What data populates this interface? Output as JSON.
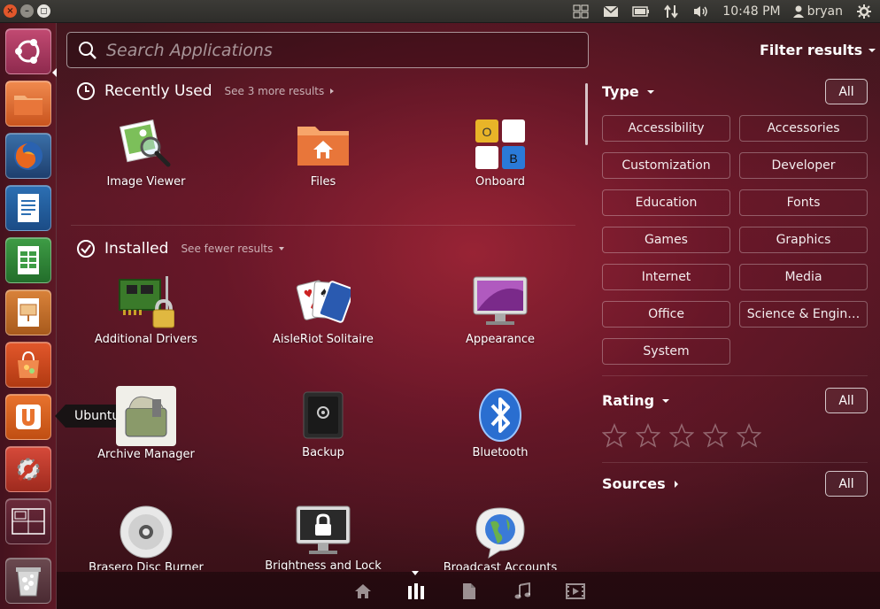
{
  "top_panel": {
    "time": "10:48 PM",
    "user": "bryan",
    "window_buttons": [
      "close-icon",
      "minimize-icon",
      "maximize-icon"
    ],
    "close_glyph": "×",
    "min_glyph": "–",
    "max_glyph": "◻",
    "indicator_icons": [
      "workspaces-icon",
      "mail-icon",
      "battery-icon",
      "network-icon",
      "volume-icon",
      "user-icon",
      "gear-icon"
    ]
  },
  "launcher": {
    "items": [
      "ubuntu-dash-icon",
      "files-icon",
      "firefox-icon",
      "writer-icon",
      "calc-icon",
      "impress-icon",
      "software-center-icon",
      "ubuntu-one-icon",
      "system-settings-icon",
      "workspace-switcher-icon",
      "trash-icon"
    ],
    "tooltip": "Ubuntu One"
  },
  "search": {
    "placeholder": "Search Applications"
  },
  "filter_results_label": "Filter results",
  "recently_used": {
    "title": "Recently Used",
    "more": "See 3 more results",
    "apps": [
      {
        "label": "Image Viewer",
        "icon": "image-viewer-icon"
      },
      {
        "label": "Files",
        "icon": "files-folder-icon"
      },
      {
        "label": "Onboard",
        "icon": "onboard-keyboard-icon"
      }
    ]
  },
  "installed": {
    "title": "Installed",
    "more": "See fewer results",
    "apps": [
      {
        "label": "Additional Drivers",
        "icon": "drivers-icon"
      },
      {
        "label": "AisleRiot Solitaire",
        "icon": "cards-icon"
      },
      {
        "label": "Appearance",
        "icon": "appearance-icon"
      },
      {
        "label": "Archive Manager",
        "icon": "archive-icon"
      },
      {
        "label": "Backup",
        "icon": "backup-safe-icon"
      },
      {
        "label": "Bluetooth",
        "icon": "bluetooth-icon"
      },
      {
        "label": "Brasero Disc Burner",
        "icon": "disc-icon"
      },
      {
        "label": "Brightness and Lock",
        "icon": "lock-screen-icon"
      },
      {
        "label": "Broadcast Accounts",
        "icon": "broadcast-globe-icon"
      }
    ]
  },
  "filters": {
    "type": {
      "title": "Type",
      "all": "All",
      "options": [
        "Accessibility",
        "Accessories",
        "Customization",
        "Developer",
        "Education",
        "Fonts",
        "Games",
        "Graphics",
        "Internet",
        "Media",
        "Office",
        "Science & Engin…",
        "System"
      ]
    },
    "rating": {
      "title": "Rating",
      "all": "All",
      "stars": 0,
      "max_stars": 5
    },
    "sources": {
      "title": "Sources",
      "all": "All"
    }
  },
  "onboard_keys": [
    "O",
    "",
    "",
    "B"
  ],
  "lenses": [
    "home-lens-icon",
    "applications-lens-icon",
    "files-lens-icon",
    "music-lens-icon",
    "video-lens-icon"
  ]
}
